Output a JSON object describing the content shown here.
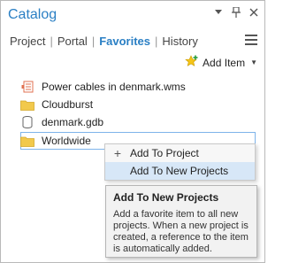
{
  "pane": {
    "title": "Catalog"
  },
  "tabs": [
    {
      "label": "Project"
    },
    {
      "label": "Portal"
    },
    {
      "label": "Favorites"
    },
    {
      "label": "History"
    }
  ],
  "toolbar": {
    "add_item_label": "Add Item"
  },
  "favorites": [
    {
      "label": "Power cables in denmark.wms",
      "icon": "wms-layer-icon"
    },
    {
      "label": "Cloudburst",
      "icon": "folder-icon"
    },
    {
      "label": "denmark.gdb",
      "icon": "geodatabase-icon"
    },
    {
      "label": "Worldwide",
      "icon": "folder-icon"
    }
  ],
  "context_menu": {
    "items": [
      {
        "label": "Add To Project",
        "icon": "plus-icon"
      },
      {
        "label": "Add To New Projects",
        "icon": ""
      }
    ]
  },
  "tooltip": {
    "title": "Add To New Projects",
    "body": "Add a favorite item to all new projects. When a new project is created, a reference to the item is automatically added."
  },
  "colors": {
    "accent": "#2a7fc4",
    "folder": "#f2c94c",
    "wms": "#e07050",
    "selection_border": "#7eb4ea",
    "menu_hover": "#d7e7f7"
  }
}
